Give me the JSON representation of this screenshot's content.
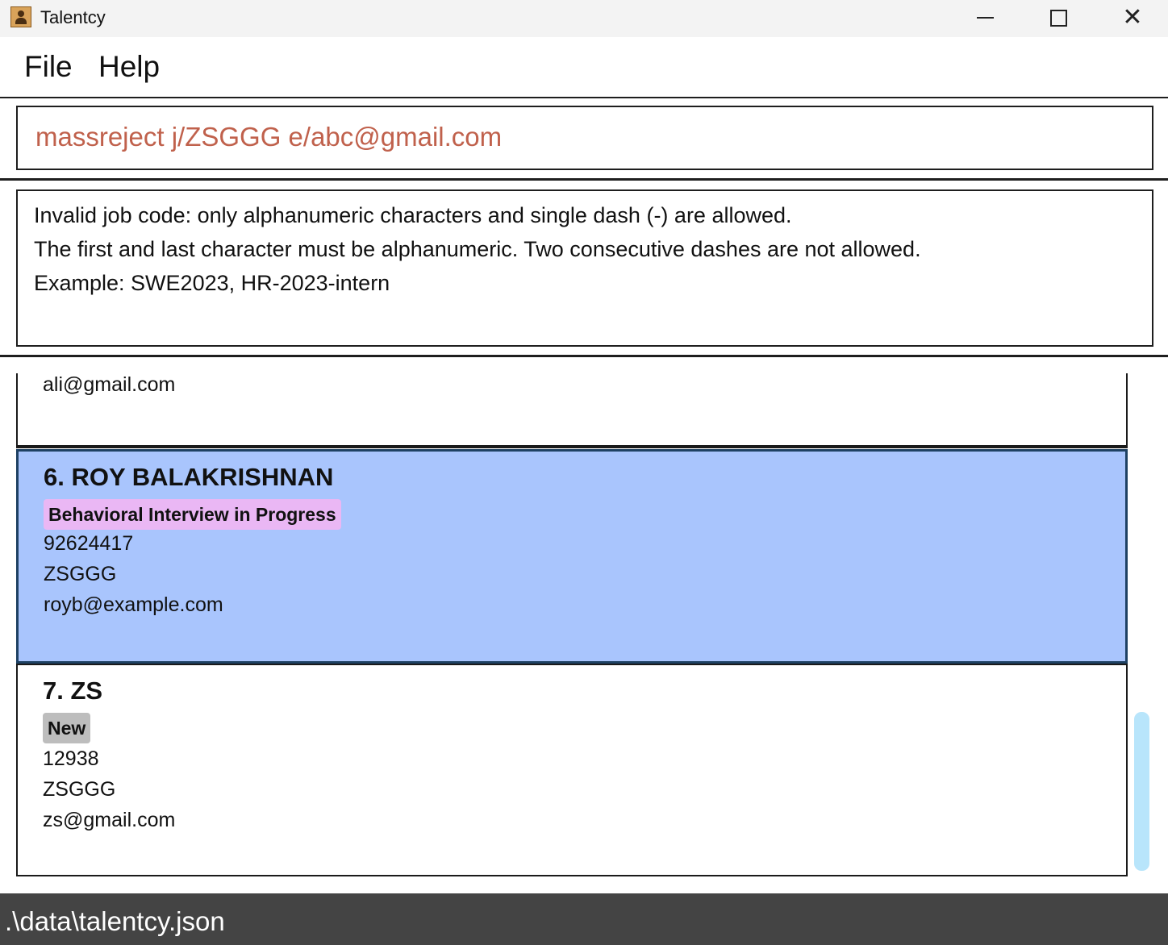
{
  "window": {
    "title": "Talentcy"
  },
  "menu": {
    "file": "File",
    "help": "Help"
  },
  "command": {
    "value": "massreject j/ZSGGG e/abc@gmail.com"
  },
  "result": {
    "lines": [
      "Invalid job code: only alphanumeric characters and single dash (-) are allowed.",
      "The first and last character must be alphanumeric. Two consecutive dashes are not allowed.",
      "Example: SWE2023, HR-2023-intern"
    ]
  },
  "list": {
    "partial_card": {
      "email": "ali@gmail.com"
    },
    "cards": [
      {
        "name": "6. ROY BALAKRISHNAN",
        "status": "Behavioral Interview in Progress",
        "status_color": "#eab7f4",
        "phone": "92624417",
        "job": "ZSGGG",
        "email": "royb@example.com",
        "selected": true
      },
      {
        "name": "7. ZS",
        "status": "New",
        "status_color": "#bdbdbd",
        "phone": "12938",
        "job": "ZSGGG",
        "email": "zs@gmail.com",
        "selected": false
      }
    ]
  },
  "status_bar": {
    "path": ".\\data\\talentcy.json"
  },
  "colors": {
    "selected_card": "#a9c5fd",
    "command_text": "#c0614c",
    "status_bar": "#444444",
    "scrollbar": "#b8e5fb"
  },
  "icons": {
    "app": "app-user-icon",
    "minimize": "minimize-icon",
    "maximize": "maximize-icon",
    "close": "close-icon"
  }
}
